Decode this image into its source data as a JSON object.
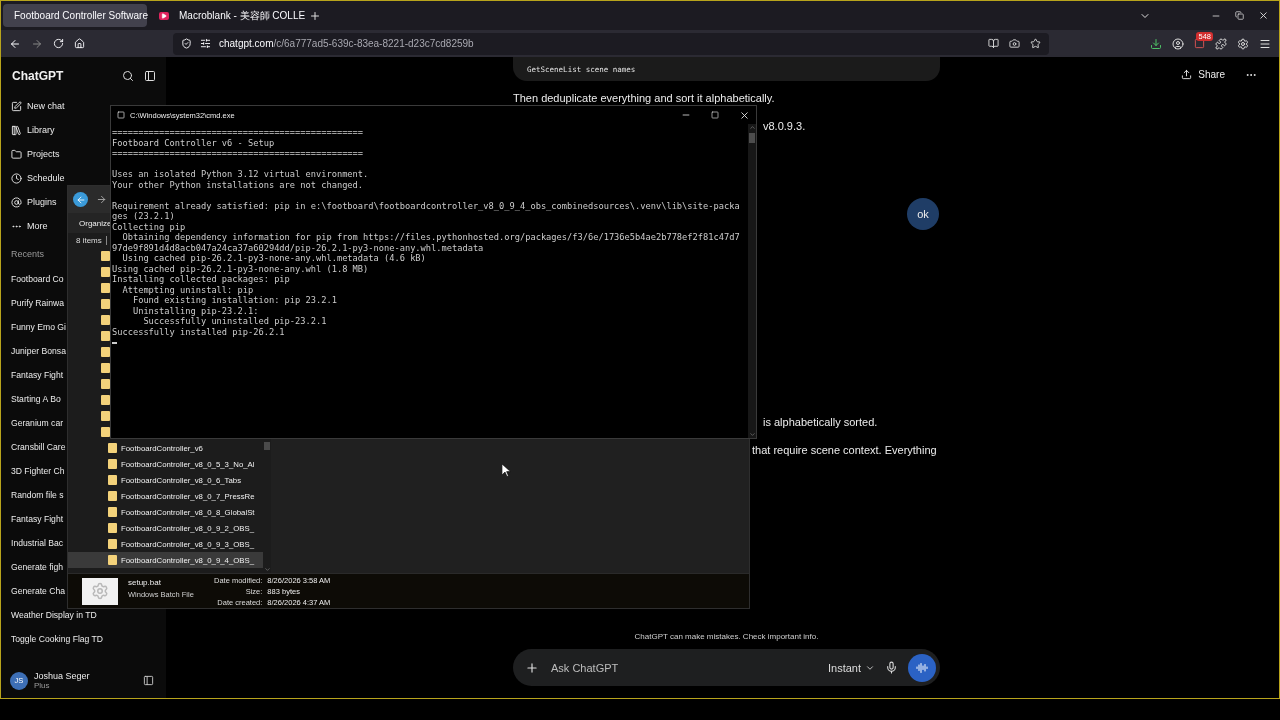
{
  "browser": {
    "tabs": [
      {
        "title": "Footboard Controller Software",
        "selected": true,
        "kind": "page"
      },
      {
        "title": "Macroblank - 美容師 COLLE",
        "selected": false,
        "kind": "video"
      }
    ],
    "url": {
      "host": "chatgpt.com",
      "path": "/c/6a777ad5-639c-83ea-8221-d23c7cd8259b"
    },
    "extension_badge": "548"
  },
  "sidebar": {
    "brand": "ChatGPT",
    "nav": [
      {
        "label": "New chat",
        "kind": "new"
      },
      {
        "label": "Library",
        "kind": "library"
      },
      {
        "label": "Projects",
        "kind": "projects"
      },
      {
        "label": "Schedule",
        "kind": "schedule"
      },
      {
        "label": "Plugins",
        "kind": "plugins"
      },
      {
        "label": "More",
        "kind": "more"
      }
    ],
    "recents_heading": "Recents",
    "recents": [
      "Footboard Co",
      "Purify Rainwa",
      "Funny Emo Gi",
      "Juniper Bonsa",
      "Fantasy Fight",
      "Starting A Bo",
      "Geranium car",
      "Cransbill Care",
      "3D Fighter Ch",
      "Random file s",
      "Fantasy Fight",
      "Industrial Bac",
      "Generate figh",
      "Generate Cha",
      "Weather Display in TD",
      "Toggle Cooking Flag TD"
    ],
    "user": {
      "initials": "JS",
      "name": "Joshua Seger",
      "plan": "Plus"
    }
  },
  "chat": {
    "share": "Share",
    "messages": [
      {
        "kind": "code",
        "text": "GetSceneList scene names"
      },
      {
        "kind": "text",
        "text": "Then deduplicate everything and sort it alphabetically."
      },
      {
        "kind": "text",
        "text": "v8.0.9.3."
      },
      {
        "kind": "user",
        "text": "ok"
      },
      {
        "kind": "text",
        "text": "is alphabetically sorted."
      },
      {
        "kind": "text",
        "text": "that require scene context. Everything"
      }
    ],
    "disclaimer": "ChatGPT can make mistakes. Check important info.",
    "composer": {
      "placeholder": "Ask ChatGPT",
      "model": "Instant"
    }
  },
  "explorer": {
    "organize": "Organize",
    "item_count": "8 items",
    "folders": [
      {
        "selected": false
      },
      {
        "selected": false
      },
      {
        "selected": false
      },
      {
        "selected": false
      },
      {
        "selected": false
      },
      {
        "selected": false
      },
      {
        "selected": false
      },
      {
        "selected": false
      },
      {
        "selected": false
      },
      {
        "selected": false
      },
      {
        "selected": false
      },
      {
        "selected": false
      },
      {
        "name": "FootboardController_v6",
        "selected": false
      },
      {
        "name": "FootboardController_v8_0_5_3_No_Al",
        "selected": false
      },
      {
        "name": "FootboardController_v8_0_6_Tabs",
        "selected": false
      },
      {
        "name": "FootboardController_v8_0_7_PressRe",
        "selected": false
      },
      {
        "name": "FootboardController_v8_0_8_GlobalSt",
        "selected": false
      },
      {
        "name": "FootboardController_v8_0_9_2_OBS_",
        "selected": false
      },
      {
        "name": "FootboardController_v8_0_9_3_OBS_",
        "selected": false
      },
      {
        "name": "FootboardController_v8_0_9_4_OBS_",
        "selected": true
      }
    ],
    "details": {
      "name": "setup.bat",
      "type": "Windows Batch File",
      "fields": [
        {
          "label": "Date modified:",
          "value": "8/26/2026 3:58 AM"
        },
        {
          "label": "Size:",
          "value": "883 bytes"
        },
        {
          "label": "Date created:",
          "value": "8/26/2026 4:37 AM"
        }
      ]
    }
  },
  "console": {
    "title": "C:\\Windows\\system32\\cmd.exe",
    "blocks": [
      [
        "================================================",
        "Footboard Controller v6 - Setup",
        "================================================"
      ],
      [
        "Uses an isolated Python 3.12 virtual environment.",
        "Your other Python installations are not changed."
      ],
      [
        "Requirement already satisfied: pip in e:\\footboard\\footboardcontroller_v8_0_9_4_obs_combinedsources\\.venv\\lib\\site-packa",
        "ges (23.2.1)",
        "Collecting pip",
        "  Obtaining dependency information for pip from https://files.pythonhosted.org/packages/f3/6e/1736e5b4ae2b778ef2f81c47d7",
        "97de9f891d4d8acb047a24ca37a60294dd/pip-26.2.1-py3-none-any.whl.metadata",
        "  Using cached pip-26.2.1-py3-none-any.whl.metadata (4.6 kB)",
        "Using cached pip-26.2.1-py3-none-any.whl (1.8 MB)",
        "Installing collected packages: pip",
        "  Attempting uninstall: pip",
        "    Found existing installation: pip 23.2.1",
        "    Uninstalling pip-23.2.1:",
        "      Successfully uninstalled pip-23.2.1",
        "Successfully installed pip-26.2.1"
      ]
    ]
  }
}
